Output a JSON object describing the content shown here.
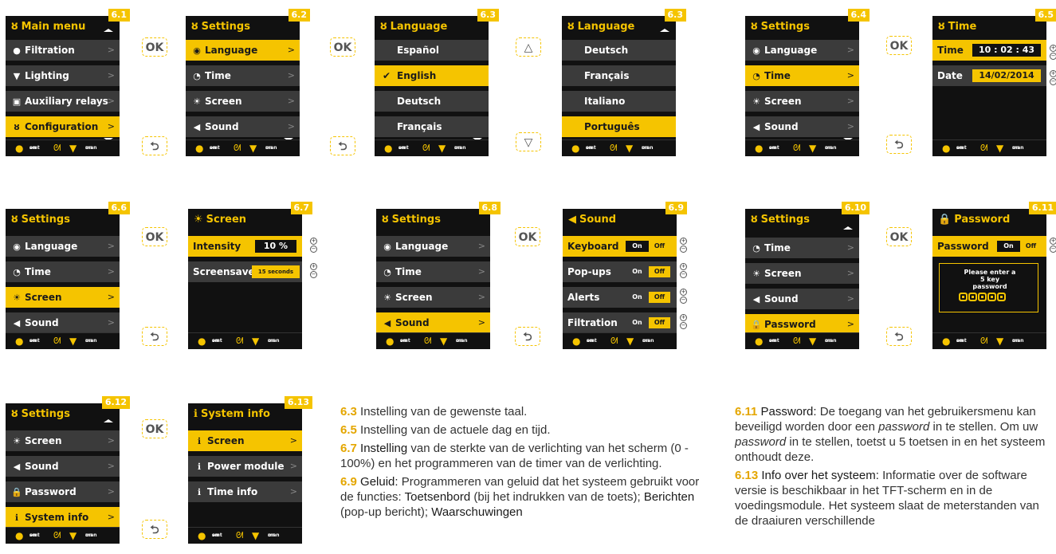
{
  "colors": {
    "accent": "#f5c400",
    "screen_bg": "#111111",
    "row_bg": "#3b3b3b"
  },
  "footer": {
    "smt": "smt",
    "on": "on",
    "man": "man"
  },
  "buttons": {
    "ok": "OK",
    "back": "⮌",
    "up": "△",
    "down": "▽"
  },
  "s61": {
    "tag": "6.1",
    "title": "Main menu",
    "items": [
      "Filtration",
      "Lighting",
      "Auxiliary relays",
      "Configuration"
    ]
  },
  "s62": {
    "tag": "6.2",
    "title": "Settings",
    "items": [
      "Language",
      "Time",
      "Screen",
      "Sound"
    ]
  },
  "s63a": {
    "tag": "6.3",
    "title": "Language",
    "items": [
      "Español",
      "English",
      "Deutsch",
      "Français"
    ]
  },
  "s63b": {
    "tag": "6.3",
    "title": "Language",
    "items": [
      "Deutsch",
      "Français",
      "Italiano",
      "Português"
    ]
  },
  "s64": {
    "tag": "6.4",
    "title": "Settings",
    "items": [
      "Language",
      "Time",
      "Screen",
      "Sound"
    ]
  },
  "s65": {
    "tag": "6.5",
    "title": "Time",
    "time_label": "Time",
    "time_value": "10 : 02 : 43",
    "date_label": "Date",
    "date_value": "14/02/2014"
  },
  "s66": {
    "tag": "6.6",
    "title": "Settings",
    "items": [
      "Language",
      "Time",
      "Screen",
      "Sound"
    ]
  },
  "s67": {
    "tag": "6.7",
    "title": "Screen",
    "intensity_label": "Intensity",
    "intensity_value": "10 %",
    "screensaver_label": "Screensaver",
    "screensaver_value": "15 seconds"
  },
  "s68": {
    "tag": "6.8",
    "title": "Settings",
    "items": [
      "Language",
      "Time",
      "Screen",
      "Sound"
    ]
  },
  "s69": {
    "tag": "6.9",
    "title": "Sound",
    "items": [
      "Keyboard",
      "Pop-ups",
      "Alerts",
      "Filtration"
    ],
    "on": "On",
    "off": "Off"
  },
  "s610": {
    "tag": "6.10",
    "title": "Settings",
    "items": [
      "Time",
      "Screen",
      "Sound",
      "Password"
    ]
  },
  "s611": {
    "tag": "6.11",
    "title": "Password",
    "label": "Password",
    "on": "On",
    "off": "Off",
    "prompt": "Please enter a 5 key password"
  },
  "s612": {
    "tag": "6.12",
    "title": "Settings",
    "items": [
      "Screen",
      "Sound",
      "Password",
      "System info"
    ]
  },
  "s613": {
    "tag": "6.13",
    "title": "System info",
    "items": [
      "Screen",
      "Power module",
      "Time info"
    ]
  },
  "text_left": {
    "p1_num": "6.3",
    "p1": " Instelling van de gewenste taal.",
    "p2_num": "6.5",
    "p2": " Instelling van de actuele dag en tijd.",
    "p3_num": "6.7",
    "p3a": " Instelling",
    "p3b": " van de sterkte van de verlichting van het scherm (0 - 100%) en het programmeren van de timer van de verlichting.",
    "p4_num": "6.9",
    "p4a": " Geluid:",
    "p4b": " Programmeren van geluid dat het systeem gebruikt voor de functies: ",
    "p4c": "Toetsenbord",
    "p4d": " (bij het indrukken van de toets); ",
    "p4e": "Berichten",
    "p4f": " (pop-up bericht); ",
    "p4g": "Waarschuwingen"
  },
  "text_right": {
    "p1_num": "6.11",
    "p1a": " Password:",
    "p1b": " De toegang van het gebruikersmenu kan beveiligd worden door een ",
    "p1c": "password",
    "p1d": " in te stellen. Om uw ",
    "p1e": "password",
    "p1f": " in te stellen, toetst u 5 toetsen in en het systeem onthoudt deze.",
    "p2_num": "6.13",
    "p2a": " Info over het systeem:",
    "p2b": " Informatie over de software versie is beschikbaar in het TFT-scherm en in de voedingsmodule. Het systeem slaat de meterstanden van de draaiuren verschillende"
  }
}
